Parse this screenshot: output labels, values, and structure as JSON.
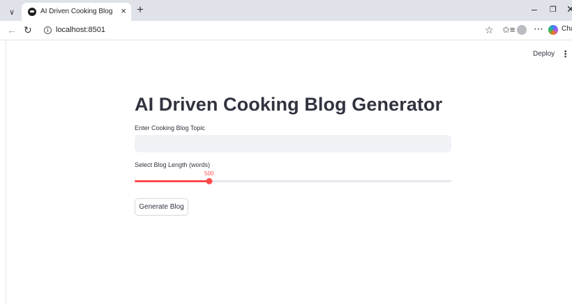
{
  "browser": {
    "tab_title": "AI Driven Cooking Blog",
    "tab_close": "×",
    "new_tab": "+",
    "tab_menu": "∨",
    "url": "localhost:8501",
    "copilot_label": "Cha",
    "window_min": "–",
    "window_restore": "❐",
    "window_close": "✕"
  },
  "app": {
    "deploy_label": "Deploy",
    "menu_icon": "⋮",
    "title": "AI Driven Cooking Blog Generator",
    "topic_label": "Enter Cooking Blog Topic",
    "topic_value": "",
    "topic_placeholder": "",
    "length_label": "Select Blog Length (words)",
    "length_value": "500",
    "length_position": 0.235,
    "generate_button": "Generate Blog",
    "accent_color": "#ff4b4b"
  },
  "icons": {
    "back": "arrow-left-icon",
    "reload": "reload-icon",
    "info": "info-icon",
    "star": "star-icon",
    "favorites": "favorites-icon",
    "profile": "profile-icon",
    "more": "more-icon",
    "copilot": "copilot-icon"
  }
}
